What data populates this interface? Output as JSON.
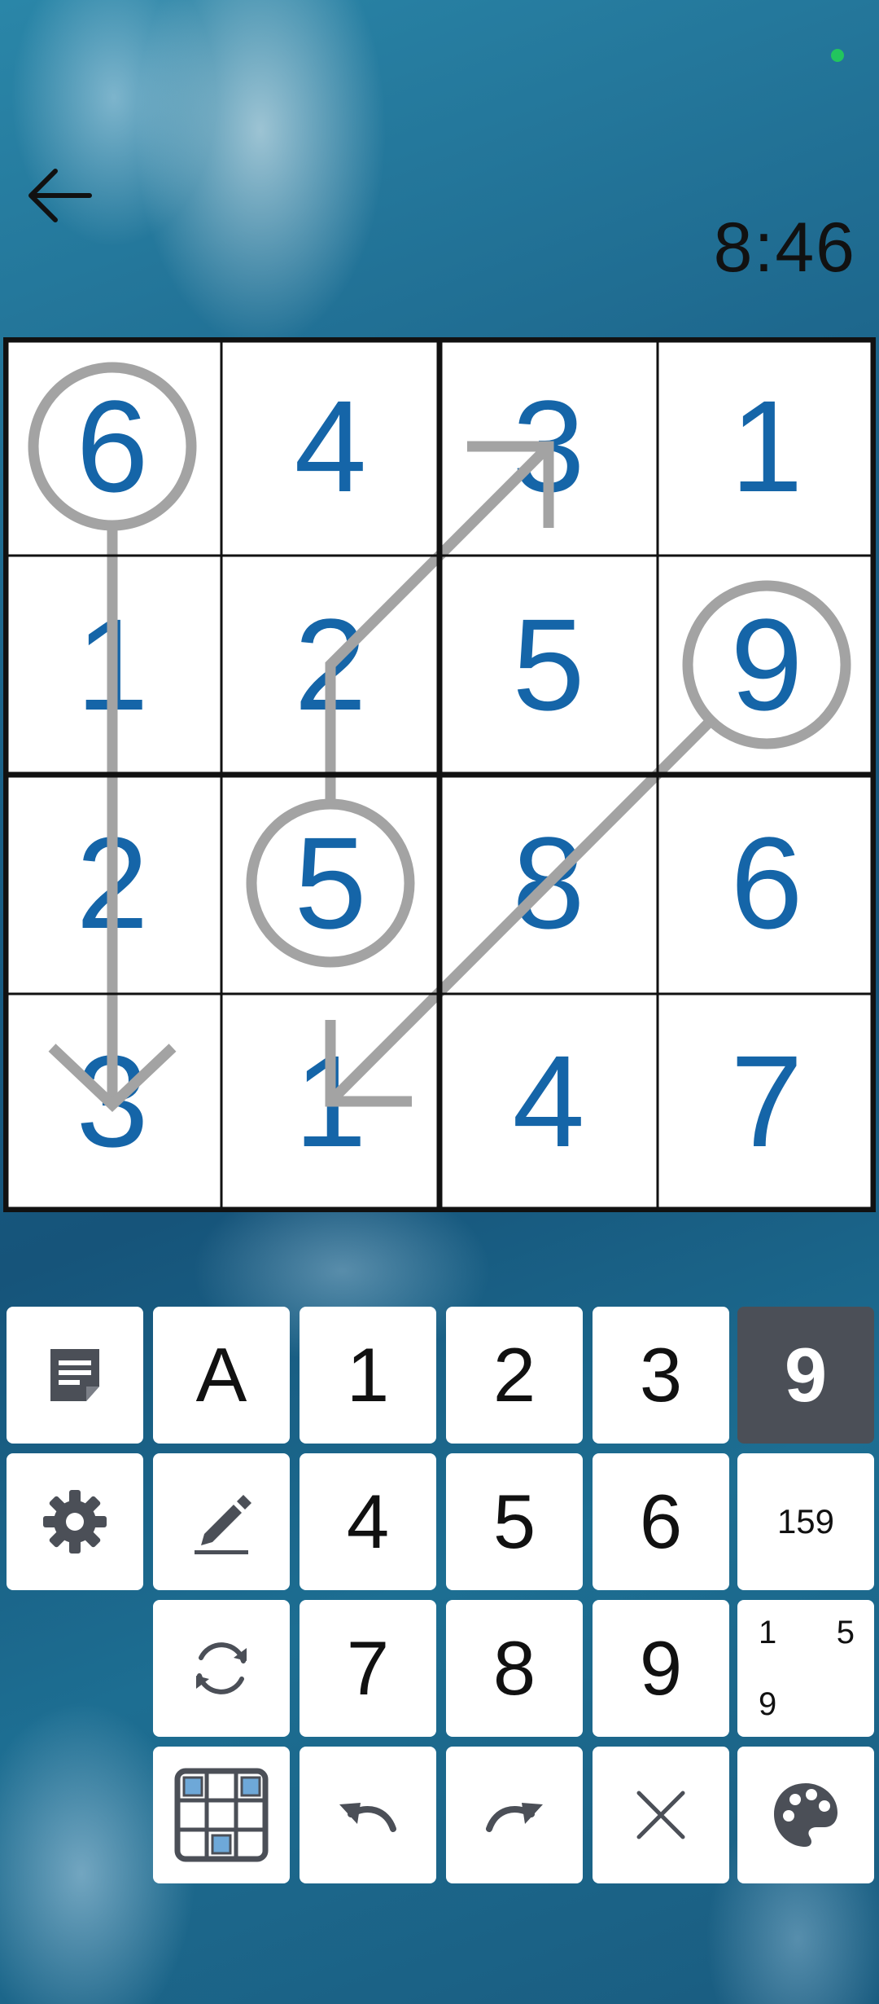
{
  "timer": "8:46",
  "board": {
    "cells": [
      [
        "6",
        "4",
        "3",
        "1"
      ],
      [
        "1",
        "2",
        "5",
        "9"
      ],
      [
        "2",
        "5",
        "8",
        "6"
      ],
      [
        "3",
        "1",
        "4",
        "7"
      ]
    ]
  },
  "keypad": {
    "letter_mode": "A",
    "digits": [
      "1",
      "2",
      "3",
      "4",
      "5",
      "6",
      "7",
      "8",
      "9"
    ],
    "active_digit": "9",
    "candidates_label": "159",
    "corner_marks": [
      "1",
      "5",
      "9"
    ]
  },
  "icons": {
    "back": "arrow-left-icon",
    "notes": "note-icon",
    "settings": "gear-icon",
    "pencil": "pencil-icon",
    "restart": "refresh-icon",
    "grid": "grid-icon",
    "undo": "undo-icon",
    "redo": "redo-icon",
    "clear": "close-icon",
    "palette": "palette-icon"
  },
  "colors": {
    "digit": "#1565a8",
    "active_key": "#4b4f57",
    "status": "#22c55e"
  }
}
